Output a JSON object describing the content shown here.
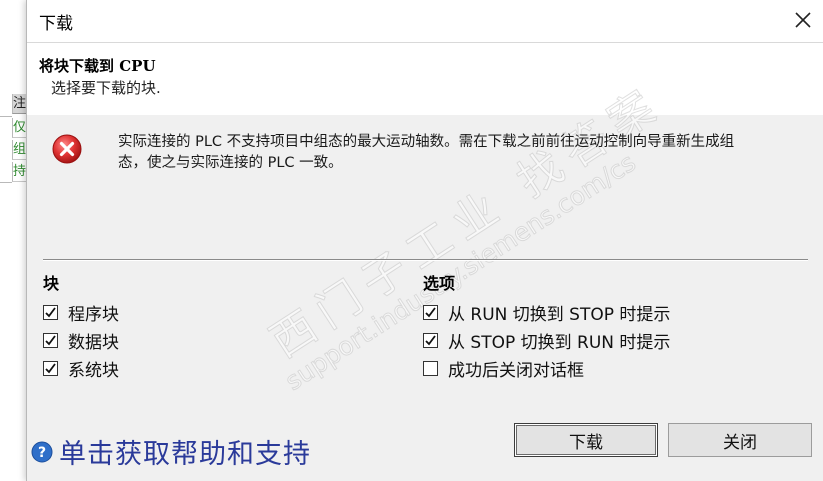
{
  "background_app": {
    "cells": [
      {
        "text": "注",
        "style": "header"
      },
      {
        "text": "仅",
        "style": "green"
      },
      {
        "text": "组",
        "style": "green"
      },
      {
        "text": "持",
        "style": "green"
      }
    ]
  },
  "dialog": {
    "title": "下载",
    "close_icon": "close-icon",
    "header": {
      "title": "将块下载到 CPU",
      "subtitle": "选择要下载的块."
    },
    "error": {
      "icon": "error-icon",
      "line1": "实际连接的 PLC 不支持项目中组态的最大运动轴数。需在下载之前前往运动控制向导重新生成组",
      "line2": "态，使之与实际连接的 PLC 一致。"
    },
    "blocks": {
      "heading": "块",
      "items": [
        {
          "label": "程序块",
          "checked": true
        },
        {
          "label": "数据块",
          "checked": true
        },
        {
          "label": "系统块",
          "checked": true
        }
      ]
    },
    "options": {
      "heading": "选项",
      "items": [
        {
          "label": "从 RUN 切换到 STOP 时提示",
          "checked": true
        },
        {
          "label": "从 STOP 切换到 RUN 时提示",
          "checked": true
        },
        {
          "label": "成功后关闭对话框",
          "checked": false
        }
      ]
    },
    "help_text": "单击获取帮助和支持",
    "buttons": {
      "download": "下载",
      "close": "关闭"
    },
    "watermark": {
      "line1": "西门子工业  找答案",
      "line2": "support.industry.siemens.com/cs"
    }
  },
  "colors": {
    "dialog_bg": "#f0f0f0",
    "help_text": "#2a3a9a",
    "error_red": "#d42a2a",
    "help_blue": "#2f6fc9",
    "bg_green": "#2f8a2f"
  }
}
